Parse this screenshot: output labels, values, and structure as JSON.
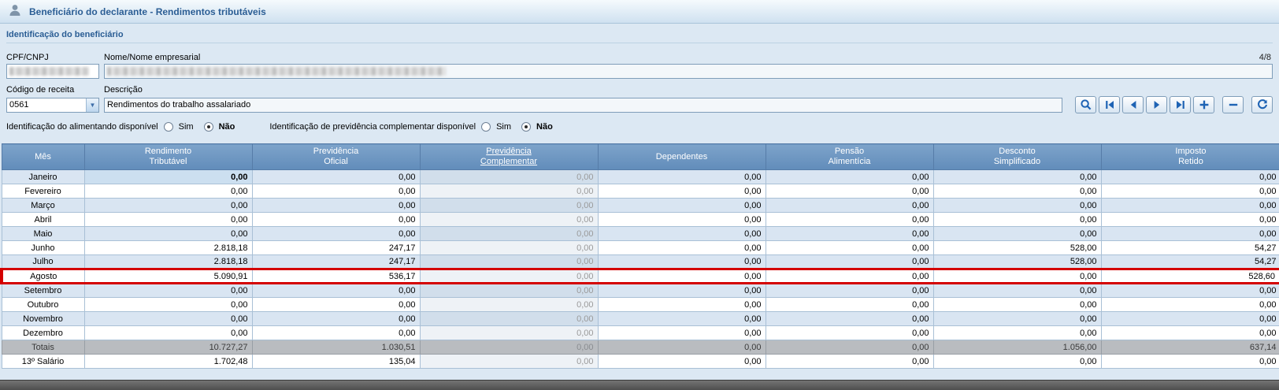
{
  "titlebar": {
    "title": "Beneficiário do declarante - Rendimentos tributáveis"
  },
  "identification": {
    "section_title": "Identificação do beneficiário",
    "fields": {
      "cpf_label": "CPF/CNPJ",
      "nome_label": "Nome/Nome empresarial",
      "record_counter": "4/8",
      "codigo_label": "Código de receita",
      "codigo_value": "0561",
      "descricao_label": "Descrição",
      "descricao_value": "Rendimentos do trabalho assalariado"
    },
    "radios": {
      "alimentando_label": "Identificação do alimentando disponível",
      "previdencia_label": "Identificação de previdência complementar disponível",
      "sim": "Sim",
      "nao": "Não",
      "alimentando_selected": "Não",
      "previdencia_selected": "Não"
    }
  },
  "toolbar": {
    "buttons": [
      "search",
      "first-record",
      "previous-record",
      "next-record",
      "last-record",
      "add-record",
      "remove-record",
      "refresh"
    ]
  },
  "table": {
    "columns": [
      {
        "lines": [
          "Mês"
        ]
      },
      {
        "lines": [
          "Rendimento",
          "Tributável"
        ]
      },
      {
        "lines": [
          "Previdência",
          "Oficial"
        ]
      },
      {
        "lines": [
          "Previdência",
          "Complementar"
        ],
        "link": true
      },
      {
        "lines": [
          "Dependentes"
        ]
      },
      {
        "lines": [
          "Pensão",
          "Alimentícia"
        ]
      },
      {
        "lines": [
          "Desconto",
          "Simplificado"
        ]
      },
      {
        "lines": [
          "Imposto",
          "Retido"
        ]
      }
    ],
    "rows": [
      {
        "label": "Janeiro",
        "values": [
          "0,00",
          "0,00",
          "0,00",
          "0,00",
          "0,00",
          "0,00",
          "0,00"
        ],
        "selected_cell": 0
      },
      {
        "label": "Fevereiro",
        "values": [
          "0,00",
          "0,00",
          "0,00",
          "0,00",
          "0,00",
          "0,00",
          "0,00"
        ]
      },
      {
        "label": "Março",
        "values": [
          "0,00",
          "0,00",
          "0,00",
          "0,00",
          "0,00",
          "0,00",
          "0,00"
        ]
      },
      {
        "label": "Abril",
        "values": [
          "0,00",
          "0,00",
          "0,00",
          "0,00",
          "0,00",
          "0,00",
          "0,00"
        ]
      },
      {
        "label": "Maio",
        "values": [
          "0,00",
          "0,00",
          "0,00",
          "0,00",
          "0,00",
          "0,00",
          "0,00"
        ]
      },
      {
        "label": "Junho",
        "values": [
          "2.818,18",
          "247,17",
          "0,00",
          "0,00",
          "0,00",
          "528,00",
          "54,27"
        ]
      },
      {
        "label": "Julho",
        "values": [
          "2.818,18",
          "247,17",
          "0,00",
          "0,00",
          "0,00",
          "528,00",
          "54,27"
        ]
      },
      {
        "label": "Agosto",
        "values": [
          "5.090,91",
          "536,17",
          "0,00",
          "0,00",
          "0,00",
          "0,00",
          "528,60"
        ],
        "highlight": true
      },
      {
        "label": "Setembro",
        "values": [
          "0,00",
          "0,00",
          "0,00",
          "0,00",
          "0,00",
          "0,00",
          "0,00"
        ]
      },
      {
        "label": "Outubro",
        "values": [
          "0,00",
          "0,00",
          "0,00",
          "0,00",
          "0,00",
          "0,00",
          "0,00"
        ]
      },
      {
        "label": "Novembro",
        "values": [
          "0,00",
          "0,00",
          "0,00",
          "0,00",
          "0,00",
          "0,00",
          "0,00"
        ]
      },
      {
        "label": "Dezembro",
        "values": [
          "0,00",
          "0,00",
          "0,00",
          "0,00",
          "0,00",
          "0,00",
          "0,00"
        ]
      },
      {
        "label": "Totais",
        "values": [
          "10.727,27",
          "1.030,51",
          "0,00",
          "0,00",
          "0,00",
          "1.056,00",
          "637,14"
        ],
        "totals": true
      },
      {
        "label": "13º Salário",
        "values": [
          "1.702,48",
          "135,04",
          "0,00",
          "0,00",
          "0,00",
          "0,00",
          "0,00"
        ]
      }
    ]
  },
  "colors": {
    "highlight_border": "#d40000",
    "table_header_bg": "#6e96c2",
    "title_text": "#2a5d94"
  }
}
